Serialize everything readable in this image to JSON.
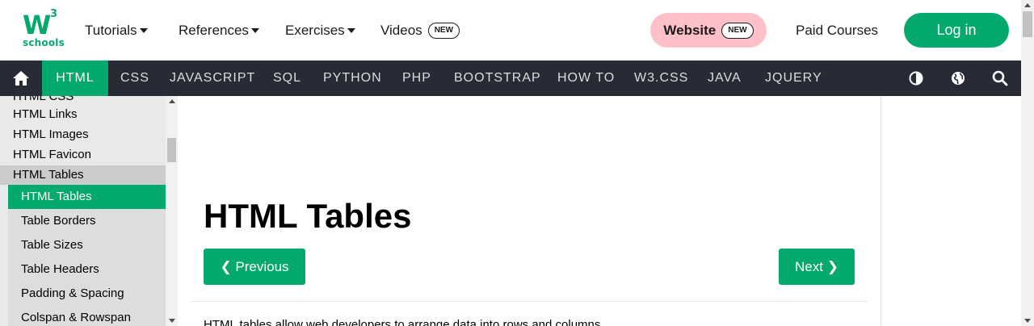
{
  "logo": {
    "mark": "W",
    "superscript": "3",
    "text": "schools"
  },
  "topnav": {
    "tutorials": "Tutorials",
    "references": "References",
    "exercises": "Exercises",
    "videos": "Videos",
    "videos_badge": "NEW",
    "website": "Website",
    "website_badge": "NEW",
    "paid_courses": "Paid Courses",
    "login": "Log in"
  },
  "colors": {
    "brand": "#04AA6D",
    "dark_nav": "#282A35",
    "website_pill": "#FFC0C7",
    "sidebar": "#E7E9EB"
  },
  "darknav": {
    "items": [
      "HTML",
      "CSS",
      "JAVASCRIPT",
      "SQL",
      "PYTHON",
      "PHP",
      "BOOTSTRAP",
      "HOW TO",
      "W3.CSS",
      "JAVA",
      "JQUERY"
    ],
    "icons": [
      "home-icon",
      "contrast-icon",
      "globe-icon",
      "search-icon"
    ]
  },
  "sidebar": {
    "partial_item": "HTML CSS",
    "links": [
      "HTML Links",
      "HTML Images",
      "HTML Favicon"
    ],
    "group": "HTML Tables",
    "sub_items": [
      "HTML Tables",
      "Table Borders",
      "Table Sizes",
      "Table Headers",
      "Padding & Spacing",
      "Colspan & Rowspan"
    ]
  },
  "main": {
    "title": "HTML Tables",
    "prev_button": "❮ Previous",
    "next_button": "Next ❯",
    "intro": "HTML tables allow web developers to arrange data into rows and columns."
  }
}
